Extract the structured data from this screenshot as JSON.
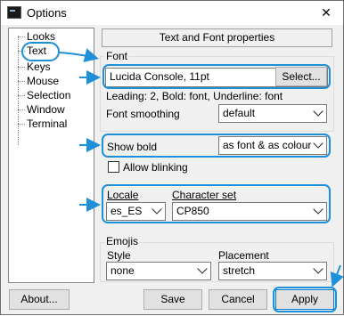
{
  "window": {
    "title": "Options",
    "close_glyph": "✕"
  },
  "tree": {
    "items": [
      "Looks",
      "Text",
      "Keys",
      "Mouse",
      "Selection",
      "Window",
      "Terminal"
    ],
    "selected": "Text"
  },
  "panel": {
    "header": "Text and Font properties"
  },
  "font": {
    "group_title": "Font",
    "value": "Lucida Console, 11pt",
    "select_button": "Select...",
    "info": "Leading: 2, Bold: font, Underline: font",
    "smoothing_label": "Font smoothing",
    "smoothing_value": "default"
  },
  "bold": {
    "label": "Show bold",
    "value": "as font & as colour",
    "blink_label": "Allow blinking",
    "blink_checked": false
  },
  "locale": {
    "label": "Locale",
    "value": "es_ES",
    "charset_label": "Character set",
    "charset_value": "CP850"
  },
  "emojis": {
    "group_title": "Emojis",
    "style_label": "Style",
    "style_value": "none",
    "placement_label": "Placement",
    "placement_value": "stretch"
  },
  "buttons": {
    "about": "About...",
    "save": "Save",
    "cancel": "Cancel",
    "apply": "Apply"
  },
  "colors": {
    "highlight": "#1e90d8",
    "window_bg": "#f0f0f0"
  }
}
